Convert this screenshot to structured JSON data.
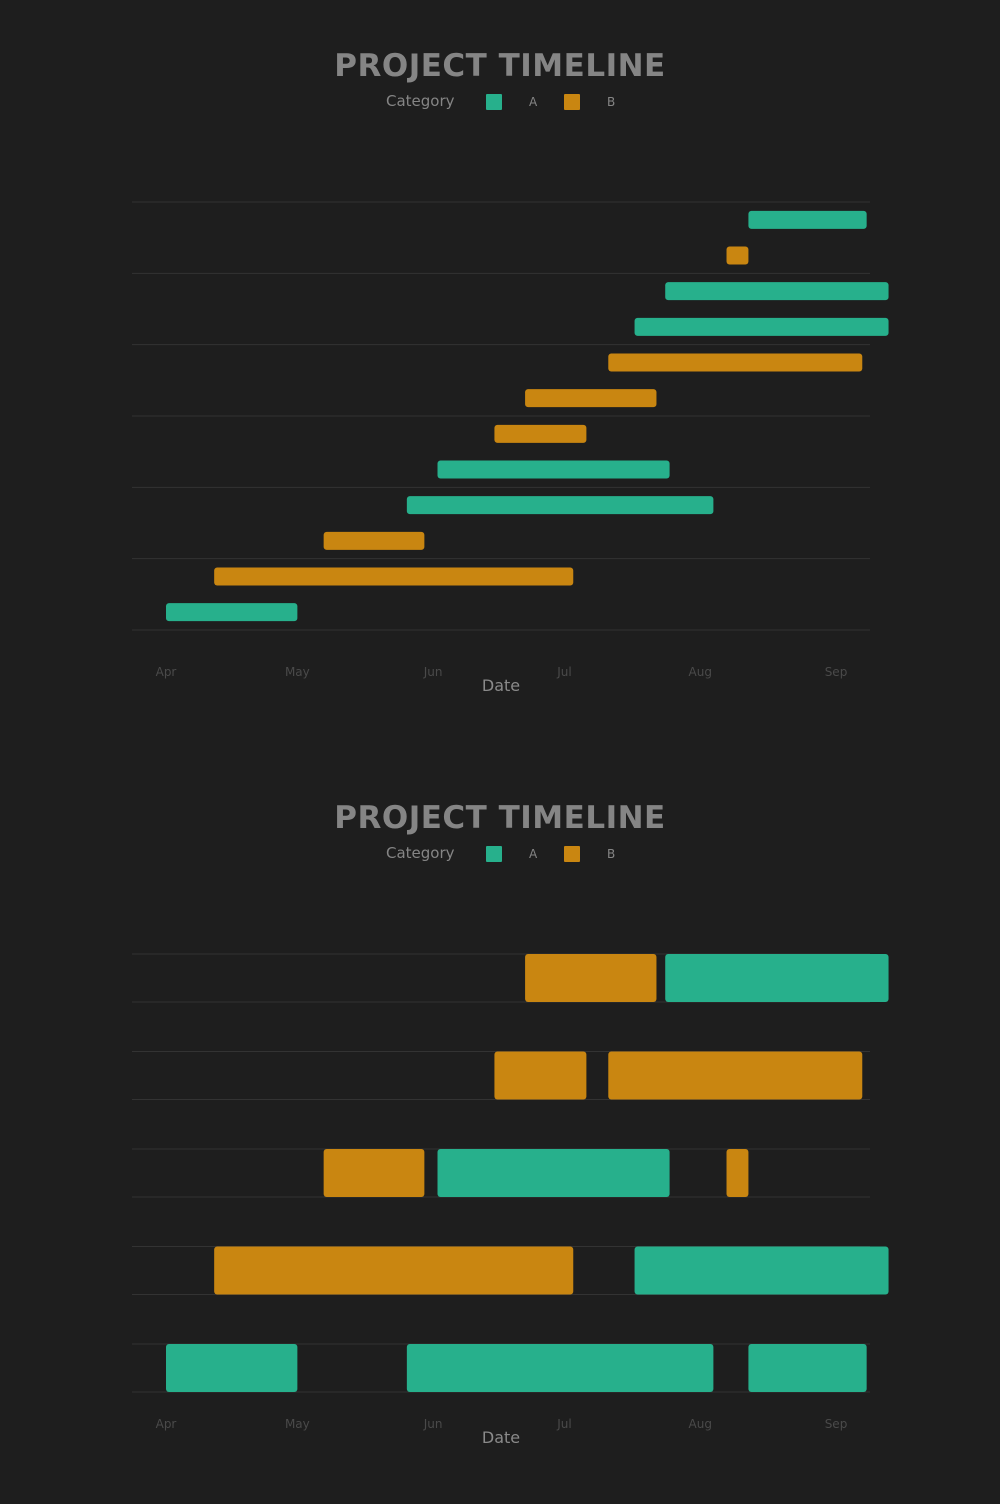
{
  "colors": {
    "A": "#27b08c",
    "B": "#c98611",
    "grid": "#333333",
    "background": "#1e1e1e"
  },
  "chart_data": [
    {
      "type": "gantt",
      "layout": "stacked",
      "title": "PROJECT TIMELINE",
      "legend": {
        "title": "Category",
        "entries": [
          "A",
          "B"
        ],
        "placement": "top-center"
      },
      "xlabel": "Date",
      "xticks": [
        "Apr",
        "May",
        "Jun",
        "Jul",
        "Aug",
        "Sep"
      ],
      "xlim": [
        "2023-04-01",
        "2023-09-01"
      ],
      "tasks": [
        {
          "category": "A",
          "start": "2023-08-12",
          "end": "2023-09-08"
        },
        {
          "category": "B",
          "start": "2023-08-07",
          "end": "2023-08-12"
        },
        {
          "category": "A",
          "start": "2023-07-24",
          "end": "2023-09-13"
        },
        {
          "category": "A",
          "start": "2023-07-17",
          "end": "2023-09-13"
        },
        {
          "category": "B",
          "start": "2023-07-11",
          "end": "2023-09-07"
        },
        {
          "category": "B",
          "start": "2023-06-22",
          "end": "2023-07-22"
        },
        {
          "category": "B",
          "start": "2023-06-15",
          "end": "2023-07-06"
        },
        {
          "category": "A",
          "start": "2023-06-02",
          "end": "2023-07-25"
        },
        {
          "category": "A",
          "start": "2023-05-26",
          "end": "2023-08-04"
        },
        {
          "category": "B",
          "start": "2023-05-07",
          "end": "2023-05-30"
        },
        {
          "category": "B",
          "start": "2023-04-12",
          "end": "2023-07-03"
        },
        {
          "category": "A",
          "start": "2023-04-01",
          "end": "2023-05-01"
        }
      ]
    },
    {
      "type": "gantt",
      "layout": "packed",
      "title": "PROJECT TIMELINE",
      "legend": {
        "title": "Category",
        "entries": [
          "A",
          "B"
        ],
        "placement": "top-center"
      },
      "xlabel": "Date",
      "xticks": [
        "Apr",
        "May",
        "Jun",
        "Jul",
        "Aug",
        "Sep"
      ],
      "xlim": [
        "2023-04-01",
        "2023-09-01"
      ],
      "lanes": [
        [
          {
            "category": "B",
            "start": "2023-06-22",
            "end": "2023-07-22"
          },
          {
            "category": "A",
            "start": "2023-07-24",
            "end": "2023-09-13"
          }
        ],
        [
          {
            "category": "B",
            "start": "2023-06-15",
            "end": "2023-07-06"
          },
          {
            "category": "B",
            "start": "2023-07-11",
            "end": "2023-09-07"
          }
        ],
        [
          {
            "category": "B",
            "start": "2023-05-07",
            "end": "2023-05-30"
          },
          {
            "category": "A",
            "start": "2023-06-02",
            "end": "2023-07-25"
          },
          {
            "category": "B",
            "start": "2023-08-07",
            "end": "2023-08-12"
          }
        ],
        [
          {
            "category": "B",
            "start": "2023-04-12",
            "end": "2023-07-03"
          },
          {
            "category": "A",
            "start": "2023-07-17",
            "end": "2023-09-13"
          }
        ],
        [
          {
            "category": "A",
            "start": "2023-04-01",
            "end": "2023-05-01"
          },
          {
            "category": "A",
            "start": "2023-05-26",
            "end": "2023-08-04"
          },
          {
            "category": "A",
            "start": "2023-08-12",
            "end": "2023-09-08"
          }
        ]
      ]
    }
  ]
}
